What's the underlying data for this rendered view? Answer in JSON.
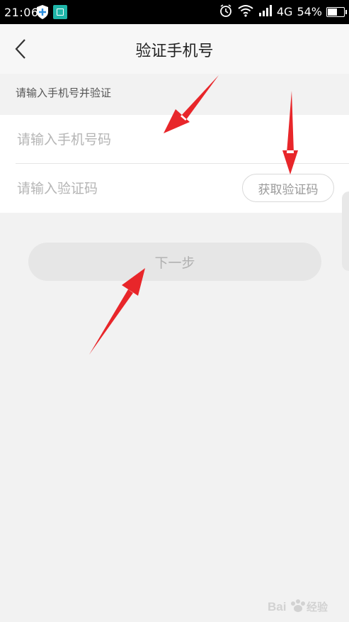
{
  "status_bar": {
    "time": "21:06",
    "network": "4G",
    "battery_percent_text": "54%",
    "battery_level": 0.54
  },
  "nav": {
    "title": "验证手机号",
    "back_icon": "chevron-left-icon"
  },
  "hint": "请输入手机号并验证",
  "form": {
    "phone_placeholder": "请输入手机号码",
    "phone_value": "",
    "code_placeholder": "请输入验证码",
    "code_value": "",
    "get_code_label": "获取验证码"
  },
  "next_label": "下一步",
  "watermark": "Bai经验",
  "colors": {
    "status_bar": "#000000",
    "nav_background": "#f7f7f7",
    "page_background": "#f2f2f2",
    "annotation_arrow": "#e8262a",
    "scan_icon": "#1fb5a8",
    "disabled_button": "#e6e6e6"
  }
}
